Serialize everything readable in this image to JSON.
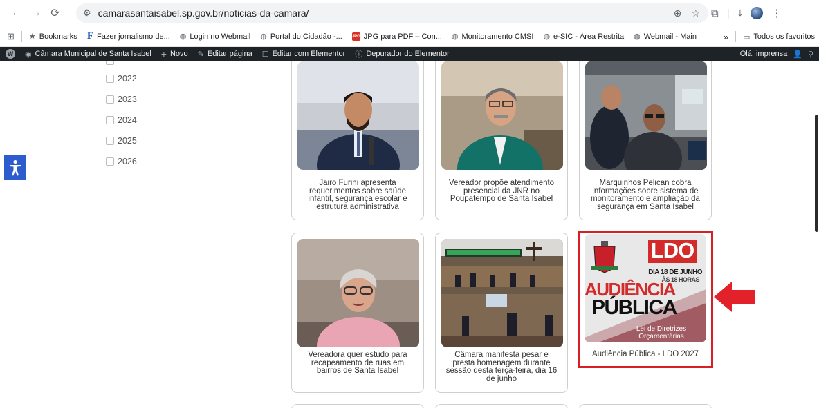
{
  "browser": {
    "url": "camarasantaisabel.sp.gov.br/noticias-da-camara/"
  },
  "bookmarks": {
    "items": [
      {
        "label": "Bookmarks"
      },
      {
        "label": "Fazer jornalismo de..."
      },
      {
        "label": "Login no Webmail"
      },
      {
        "label": "Portal do Cidadão -..."
      },
      {
        "label": "JPG para PDF – Con..."
      },
      {
        "label": "Monitoramento CMSI"
      },
      {
        "label": "e-SIC - Área Restrita"
      },
      {
        "label": "Webmail - Main"
      }
    ],
    "more": "»",
    "all_label": "Todos os favoritos"
  },
  "wpbar": {
    "site": "Câmara Municipal de Santa Isabel",
    "new": "Novo",
    "edit": "Editar página",
    "elementor": "Editar com Elementor",
    "debugger": "Depurador do Elementor",
    "greeting": "Olá, imprensa"
  },
  "sidebar": {
    "years": [
      {
        "label": "2022"
      },
      {
        "label": "2023"
      },
      {
        "label": "2024"
      },
      {
        "label": "2025"
      },
      {
        "label": "2026"
      }
    ]
  },
  "cards": [
    {
      "title": "Jairo Furini apresenta requerimentos sobre saúde infantil, segurança escolar e estrutura administrativa"
    },
    {
      "title": "Vereador propõe atendimento presencial da JNR no Poupatempo de Santa Isabel"
    },
    {
      "title": "Marquinhos Pelican cobra informações sobre sistema de monitoramento e ampliação da segurança em Santa Isabel"
    },
    {
      "title": "Vereadora quer estudo para recapeamento de ruas em bairros de Santa Isabel"
    },
    {
      "title": "Câmara manifesta pesar e presta homenagem durante sessão desta terça-feira, dia 16 de junho"
    },
    {
      "title": "Audiência Pública - LDO 2027"
    }
  ],
  "ldo_poster": {
    "badge": "LDO",
    "date": "DIA 18 DE JUNHO",
    "time": "ÀS 18 HORAS",
    "line1": "AUDIÊNCIA",
    "line2": "PÚBLICA",
    "footer1": "Lei de Diretrizes",
    "footer2": "Orçamentárias"
  },
  "colors": {
    "highlight": "#d91f26",
    "wpbar": "#1d2327",
    "accessibility": "#2d5ccf"
  }
}
